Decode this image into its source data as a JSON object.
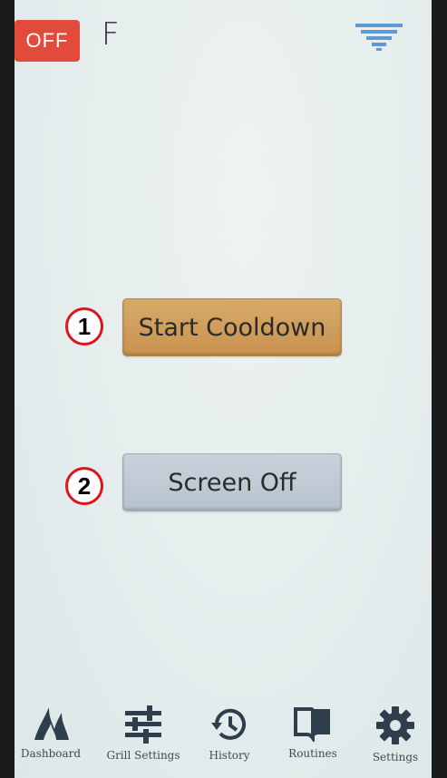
{
  "status_bar": {
    "power_state": "OFF",
    "temperature_unit": "F",
    "signal_icon": "signal-strength-icon"
  },
  "actions": {
    "start_cooldown_label": "Start Cooldown",
    "screen_off_label": "Screen Off"
  },
  "annotations": {
    "marker_1": "1",
    "marker_2": "2",
    "marker_color": "#e0141a"
  },
  "nav": {
    "items": [
      {
        "label": "Dashboard",
        "icon": "flame-icon"
      },
      {
        "label": "Grill Settings",
        "icon": "sliders-icon"
      },
      {
        "label": "History",
        "icon": "history-icon"
      },
      {
        "label": "Routines",
        "icon": "book-icon"
      },
      {
        "label": "Settings",
        "icon": "gear-icon"
      }
    ]
  },
  "colors": {
    "off_badge": "#e24a3b",
    "cooldown_button": "#cf9d5b",
    "screen_off_button": "#bfcad4",
    "nav_icon": "#2f3e4d"
  }
}
